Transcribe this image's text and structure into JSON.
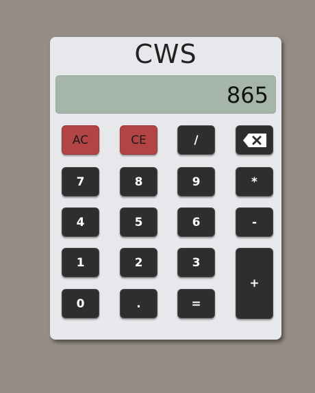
{
  "app": {
    "title": "CWS"
  },
  "display": {
    "value": "865"
  },
  "keys": {
    "ac": "AC",
    "ce": "CE",
    "divide": "/",
    "backspace_icon": "backspace-icon",
    "seven": "7",
    "eight": "8",
    "nine": "9",
    "multiply": "*",
    "four": "4",
    "five": "5",
    "six": "6",
    "minus": "-",
    "one": "1",
    "two": "2",
    "three": "3",
    "plus": "+",
    "zero": "0",
    "dot": ".",
    "equals": "="
  },
  "colors": {
    "background": "#958d84",
    "body": "#e6e8eb",
    "display": "#a6b5aa",
    "key_dark": "#2f2e2e",
    "key_red": "#b24445"
  }
}
